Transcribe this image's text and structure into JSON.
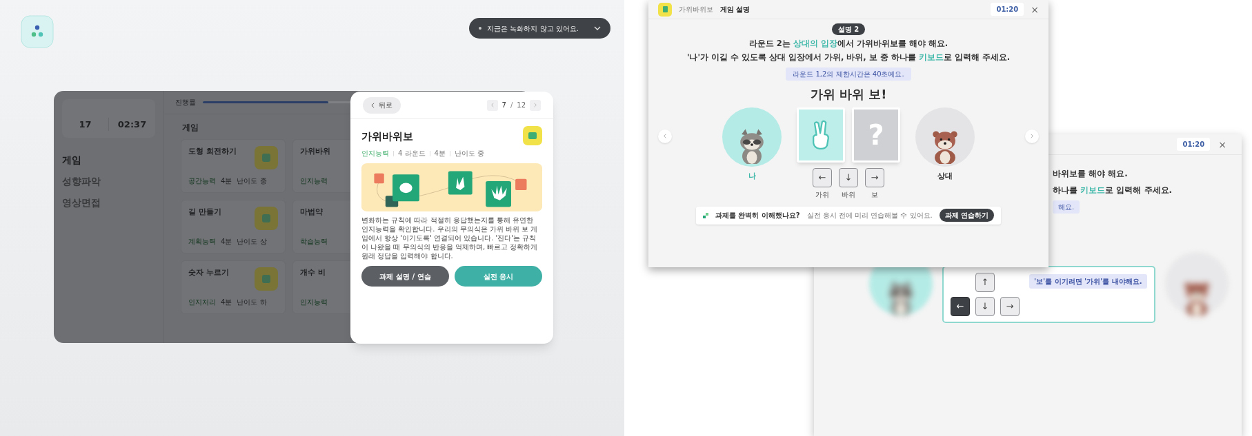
{
  "dashboard": {
    "toast": {
      "text": "지금은 녹화하지 않고 있어요."
    },
    "stats": [
      {
        "value": "17"
      },
      {
        "value": "02:37"
      }
    ],
    "menu": [
      {
        "label": "게임",
        "selected": true
      },
      {
        "label": "성향파악",
        "selected": false
      },
      {
        "label": "영상면접",
        "selected": false
      }
    ],
    "progress": {
      "label": "진행률",
      "level": 0.55
    },
    "section_title": "게임",
    "cards": [
      {
        "title": "도형 회전하기",
        "meta": [
          "공간능력",
          "4분",
          "난이도 중"
        ]
      },
      {
        "title": "가위바위",
        "meta": [
          "인지능력"
        ]
      },
      {
        "title": "길 만들기",
        "meta": [
          "계획능력",
          "4분",
          "난이도 상"
        ]
      },
      {
        "title": "마법약",
        "meta": [
          "학습능력"
        ]
      },
      {
        "title": "숫자 누르기",
        "meta": [
          "인지처리",
          "4분",
          "난이도 하"
        ]
      },
      {
        "title": "개수 비",
        "meta": [
          "인지능력"
        ]
      }
    ]
  },
  "detail_modal": {
    "back": "뒤로",
    "pager": {
      "current": "7",
      "separator": "/",
      "total": "12"
    },
    "title": "가위바위보",
    "meta": [
      {
        "text": "인지능력",
        "kind": "category"
      },
      {
        "text": "4 라운드",
        "kind": "plain"
      },
      {
        "text": "4분",
        "kind": "plain"
      },
      {
        "text": "난이도 중",
        "kind": "plain"
      }
    ],
    "description": "변화하는 규칙에 따라 적절히 응답했는지를 통해 유연한 인지능력을 확인합니다. 우리의 무의식은 가위 바위 보 게임에서 항상 '이기도록' 연결되어 있습니다. '진다'는 규칙이 나왔을 때 무의식의 반응을 억제하며, 빠르고 정확하게 원래 정답을 입력해야 합니다.",
    "buttons": [
      {
        "label": "과제 설명 / 연습",
        "kind": "secondary"
      },
      {
        "label": "실전 응시",
        "kind": "primary"
      }
    ]
  },
  "instruction_window": {
    "breadcrumb": [
      {
        "label": "가위바위보",
        "selected": false
      },
      {
        "label": "게임 설명",
        "selected": true
      }
    ],
    "timer": "01:20",
    "close": "×",
    "step": "설명 2",
    "heading": [
      [
        {
          "text": "라운드 2는 ",
          "accent": false
        },
        {
          "text": "상대의 입장",
          "accent": true
        },
        {
          "text": "에서 가위바위보를 해야 해요.",
          "accent": false
        }
      ],
      [
        {
          "text": "'나'가 이길 수 있도록 상대 입장에서 가위, 바위, 보 중 하나를 ",
          "accent": false
        },
        {
          "text": "키보드",
          "accent": true
        },
        {
          "text": "로 입력해 주세요.",
          "accent": false
        }
      ]
    ],
    "notice": "라운드 1,2의 제한시간은 40초예요.",
    "game_title": "가위 바위 보!",
    "players": [
      {
        "name": "나",
        "kind": "raccoon",
        "selected": true
      },
      {
        "name": "상대",
        "kind": "otter",
        "selected": false
      }
    ],
    "choices": [
      {
        "kind": "hand",
        "selected": true
      },
      {
        "kind": "hidden",
        "text": "?",
        "selected": false
      }
    ],
    "keys": [
      {
        "key": "←",
        "caption": "가위"
      },
      {
        "key": "↓",
        "caption": "바위"
      },
      {
        "key": "→",
        "caption": "보"
      }
    ],
    "practice_bar": {
      "question": "과제를 완벽히 이해했나요?",
      "hint": "실전 응시 전에 미리 연습해볼 수 있어요.",
      "button": "과제 연습하기"
    }
  },
  "hint_window": {
    "timer": "01:20",
    "close": "×",
    "heading": [
      [
        {
          "text": "바위보를 해야 해요.",
          "accent": false
        }
      ],
      [
        {
          "text": "하나를 ",
          "accent": false
        },
        {
          "text": "키보드",
          "accent": true
        },
        {
          "text": "로 입력해 주세요.",
          "accent": false
        }
      ]
    ],
    "notice": "해요.",
    "key_rows": [
      [
        {
          "key": "↑",
          "selected": false
        }
      ],
      [
        {
          "key": "←",
          "selected": true
        },
        {
          "key": "↓",
          "selected": false
        },
        {
          "key": "→",
          "selected": false
        }
      ]
    ],
    "tooltip": "'보'를 이기려면 '가위'를 내야해요."
  }
}
